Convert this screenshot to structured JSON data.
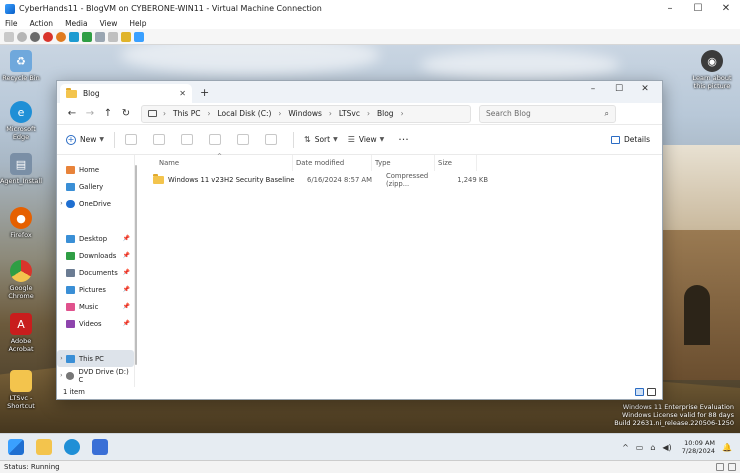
{
  "host": {
    "title": "CyberHands11 - BlogVM on CYBERONE-WIN11 - Virtual Machine Connection",
    "menu": [
      "File",
      "Action",
      "Media",
      "View",
      "Help"
    ],
    "status": "Status: Running"
  },
  "desktop_icons": [
    {
      "label": "Recycle Bin",
      "icon": "recycle-bin-icon",
      "color": "#6fa8dc"
    },
    {
      "label": "Microsoft Edge",
      "icon": "edge-icon",
      "color": "#1f8fd6"
    },
    {
      "label": "Agent_Install",
      "icon": "installer-icon",
      "color": "#7a8fa6"
    },
    {
      "label": "Firefox",
      "icon": "firefox-icon",
      "color": "#e66000"
    },
    {
      "label": "Google Chrome",
      "icon": "chrome-icon",
      "color": "#2f9e44"
    },
    {
      "label": "Adobe Acrobat",
      "icon": "acrobat-icon",
      "color": "#c81d1d"
    },
    {
      "label": "LTSvc - Shortcut",
      "icon": "folder-shortcut-icon",
      "color": "#f3c44d"
    }
  ],
  "learn_icon": {
    "label": "Learn about this picture",
    "icon": "camera-icon"
  },
  "watermark": [
    "Windows 11 Enterprise Evaluation",
    "Windows License valid for 88 days",
    "Build 22631.ni_release.220506-1250"
  ],
  "explorer": {
    "tab_title": "Blog",
    "breadcrumbs": [
      "This PC",
      "Local Disk (C:)",
      "Windows",
      "LTSvc",
      "Blog"
    ],
    "search_placeholder": "Search Blog",
    "commands": {
      "new": "New",
      "sort": "Sort",
      "view": "View",
      "details": "Details"
    },
    "nav_items": [
      {
        "label": "Home",
        "icon": "home-icon",
        "color": "#e8833a",
        "expandable": false,
        "pinned": false
      },
      {
        "label": "Gallery",
        "icon": "gallery-icon",
        "color": "#3a8fd6",
        "expandable": false,
        "pinned": false
      },
      {
        "label": "OneDrive",
        "icon": "onedrive-icon",
        "color": "#1f6fd1",
        "expandable": true,
        "pinned": false
      },
      {
        "label": "",
        "icon": "",
        "color": "",
        "expandable": false,
        "pinned": false
      },
      {
        "label": "Desktop",
        "icon": "desktop-icon",
        "color": "#3a8fd6",
        "expandable": false,
        "pinned": true
      },
      {
        "label": "Downloads",
        "icon": "downloads-icon",
        "color": "#2f9e44",
        "expandable": false,
        "pinned": true
      },
      {
        "label": "Documents",
        "icon": "documents-icon",
        "color": "#6b7c93",
        "expandable": false,
        "pinned": true
      },
      {
        "label": "Pictures",
        "icon": "pictures-icon",
        "color": "#3a8fd6",
        "expandable": false,
        "pinned": true
      },
      {
        "label": "Music",
        "icon": "music-icon",
        "color": "#e0528d",
        "expandable": false,
        "pinned": true
      },
      {
        "label": "Videos",
        "icon": "videos-icon",
        "color": "#8e44ad",
        "expandable": false,
        "pinned": true
      }
    ],
    "nav_bottom": [
      {
        "label": "This PC",
        "icon": "this-pc-icon",
        "color": "#3a8fd6",
        "selected": true
      },
      {
        "label": "DVD Drive (D:) C",
        "icon": "dvd-icon",
        "color": "#777777",
        "selected": false
      }
    ],
    "columns": [
      "Name",
      "Date modified",
      "Type",
      "Size"
    ],
    "files": [
      {
        "name": "Windows 11 v23H2 Security Baseline",
        "date": "6/16/2024 8:57 AM",
        "type": "Compressed (zipp...",
        "size": "1,249 KB"
      }
    ],
    "status": "1 item"
  },
  "taskbar": {
    "apps": [
      "start-icon",
      "file-explorer-icon",
      "edge-icon",
      "store-icon"
    ],
    "time": "10:09 AM",
    "date": "7/28/2024"
  }
}
